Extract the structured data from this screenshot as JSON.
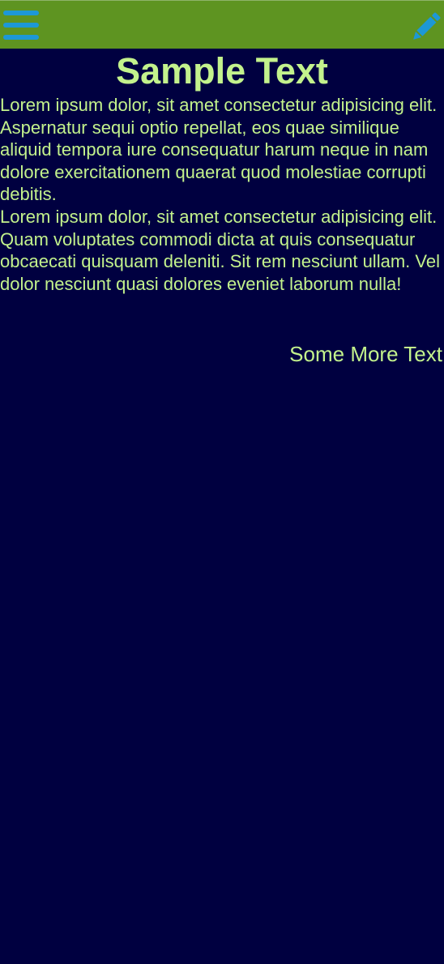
{
  "colors": {
    "background": "#000040",
    "header": "#5e9421",
    "text": "#c3f28c",
    "icon": "#1d98d6"
  },
  "header": {
    "menu_icon": "hamburger-menu-icon",
    "edit_icon": "pencil-icon"
  },
  "content": {
    "title": "Sample Text",
    "paragraphs": [
      "Lorem ipsum dolor, sit amet consectetur adipisicing elit. Aspernatur sequi optio repellat, eos quae similique aliquid tempora iure consequatur harum neque in nam dolore exercitationem quaerat quod molestiae corrupti debitis.",
      "Lorem ipsum dolor, sit amet consectetur adipisicing elit. Quam voluptates commodi dicta at quis consequatur obcaecati quisquam deleniti. Sit rem nesciunt ullam. Vel dolor nesciunt quasi dolores eveniet laborum nulla!"
    ],
    "side_text": "Some More Text"
  }
}
